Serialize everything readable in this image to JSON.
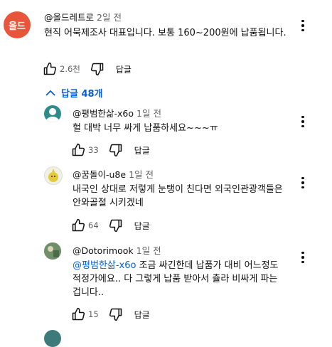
{
  "main_comment": {
    "avatar_text": "올드",
    "author": "@올드레트로",
    "time": "2일 전",
    "text": "현직 어묵제조사 대표입니다. 보통 160~200원에 납품됩니다.",
    "likes": "2.6천",
    "reply_label": "답글"
  },
  "replies_toggle": {
    "label": "답글 48개"
  },
  "replies": [
    {
      "author": "@평범한삶-x6o",
      "time": "1일 전",
      "text": "헐 대박  너무 싸게 납품하세요~~~ㅠ",
      "likes": "33",
      "reply_label": "답글"
    },
    {
      "author": "@꿈돌이-u8e",
      "time": "1일 전",
      "text": "내국인 상대로 저렇게 눈탱이 친다면 외국인관광객들은 안와골절 시키겠네",
      "likes": "64",
      "reply_label": "답글"
    },
    {
      "author": "@Dotorimook",
      "time": "1일 전",
      "mention": "@평범한삶-x6o",
      "text": " 조금 싸긴한데 납품가 대비 어느정도 적정가에요.. 다 그렇게 납품 받아서 츌라 비싸게 파는겁니다..",
      "likes": "15",
      "reply_label": "답글"
    }
  ],
  "colors": {
    "link": "#065fd4",
    "main_avatar": "#e8553b",
    "secondary_text": "#606060"
  }
}
